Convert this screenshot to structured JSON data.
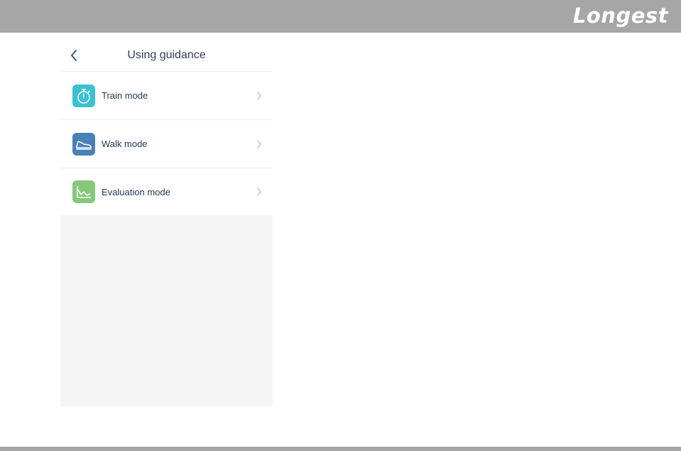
{
  "brand": {
    "logo_text": "Longest"
  },
  "header": {
    "title": "Using guidance",
    "back_icon": "chevron-left-icon"
  },
  "menu": {
    "items": [
      {
        "label": "Train mode",
        "icon": "stopwatch-icon",
        "color": "#3cc0d4"
      },
      {
        "label": "Walk mode",
        "icon": "shoe-icon",
        "color": "#4a80b8"
      },
      {
        "label": "Evaluation mode",
        "icon": "chart-icon",
        "color": "#86c87a"
      }
    ]
  },
  "colors": {
    "top_bar": "#a6a6a6",
    "title_text": "#2c3e5a",
    "panel_bg": "#f5f5f5"
  }
}
